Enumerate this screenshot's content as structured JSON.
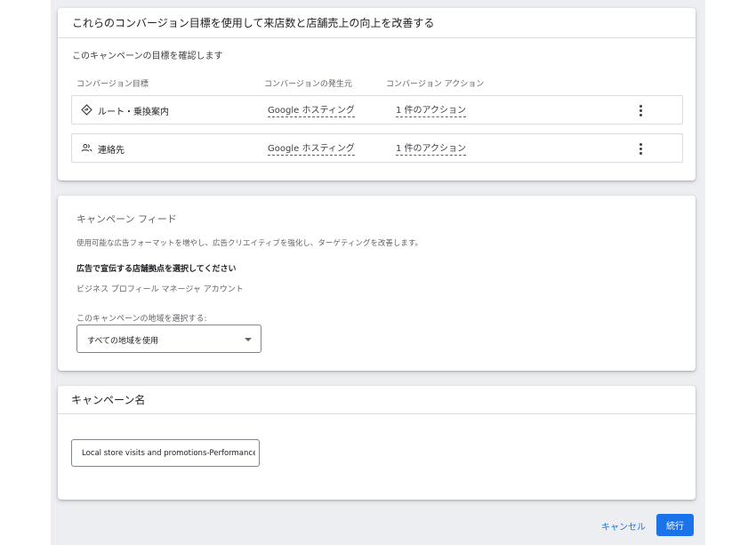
{
  "conversion_card": {
    "title": "これらのコンバージョン目標を使用して来店数と店舗売上の向上を改善する",
    "subtitle": "このキャンペーンの目標を確認します",
    "columns": {
      "goal": "コンバージョン目標",
      "source": "コンバージョンの発生元",
      "action": "コンバージョン アクション"
    },
    "rows": [
      {
        "icon": "directions-icon",
        "label": "ルート・乗換案内",
        "source": "Google ホスティング",
        "action": "1 件のアクション"
      },
      {
        "icon": "contacts-icon",
        "label": "連絡先",
        "source": "Google ホスティング",
        "action": "1 件のアクション"
      }
    ]
  },
  "feed_card": {
    "title": "キャンペーン フィード",
    "description": "使用可能な広告フォーマットを増やし、広告クリエイティブを強化し、ターゲティングを改善します。",
    "store_heading": "広告で宣伝する店舗拠点を選択してください",
    "gbp_account": "ビジネス プロフィール マネージャ アカウント",
    "region_label": "このキャンペーンの地域を選択する:",
    "region_value": "すべての地域を使用"
  },
  "name_card": {
    "title": "キャンペーン名",
    "campaign_name": "Local store visits and promotions-Performance M"
  },
  "footer": {
    "cancel_label": "キャンセル",
    "continue_label": "続行"
  },
  "colors": {
    "accent": "#1a73e8",
    "background": "#eceef1"
  }
}
